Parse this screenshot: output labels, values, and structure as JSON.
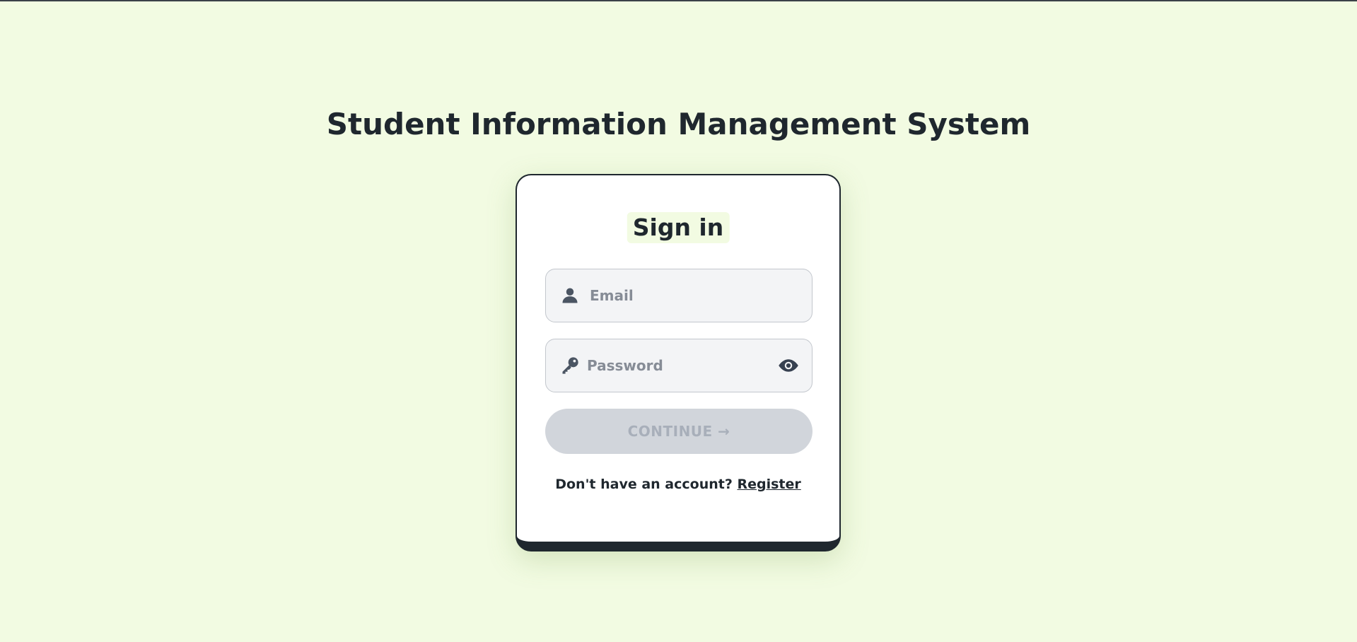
{
  "page": {
    "title": "Student Information Management System"
  },
  "card": {
    "heading": "Sign in",
    "email": {
      "placeholder": "Email",
      "value": "",
      "icon": "user-icon"
    },
    "password": {
      "placeholder": "Password",
      "value": "",
      "icon": "key-icon",
      "toggle_icon": "eye-icon"
    },
    "continue_label": "CONTINUE →",
    "footer": {
      "prompt": "Don't have an account? ",
      "link_label": "Register"
    }
  },
  "colors": {
    "background": "#f2fbe2",
    "card": "#ffffff",
    "text": "#1f272e",
    "field_bg": "#f3f4f6",
    "button_disabled_bg": "#d1d5db",
    "button_disabled_text": "#a8afba",
    "placeholder": "#868c96"
  }
}
